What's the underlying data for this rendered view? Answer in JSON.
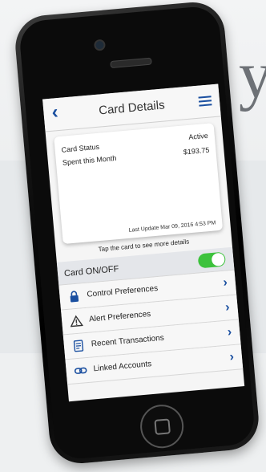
{
  "background": {
    "letter": "y"
  },
  "nav": {
    "back_icon": "chevron-left-icon",
    "title": "Card Details",
    "menu_icon": "hamburger-menu-icon"
  },
  "card": {
    "status_label": "Card Status",
    "status_value": "Active",
    "spent_label": "Spent this Month",
    "spent_value": "$193.75",
    "last_update": "Last Update Mar 09, 2016 4:53 PM"
  },
  "hint": "Tap the card to see more details",
  "toggle_row": {
    "label": "Card ON/OFF",
    "state": true
  },
  "menu": [
    {
      "label": "Control Preferences",
      "icon": "lock-icon"
    },
    {
      "label": "Alert Preferences",
      "icon": "warning-triangle-icon"
    },
    {
      "label": "Recent Transactions",
      "icon": "document-icon"
    },
    {
      "label": "Linked Accounts",
      "icon": "link-icon"
    }
  ],
  "colors": {
    "accent": "#1a4fa0",
    "toggle_on": "#3cc23c"
  }
}
